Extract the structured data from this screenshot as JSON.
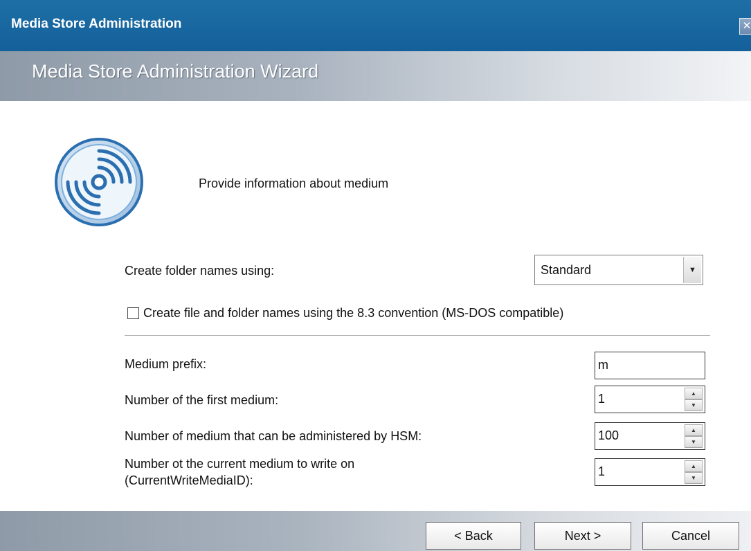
{
  "window": {
    "title": "Media Store Administration",
    "close_glyph": "✕"
  },
  "header": {
    "title": "Media Store Administration Wizard"
  },
  "main": {
    "instruction": "Provide information about medium",
    "folder_names_label": "Create folder names using:",
    "folder_names_value": "Standard",
    "dos_checkbox_label": "Create file and folder names using the 8.3 convention (MS-DOS compatible)",
    "dos_checkbox_checked": false,
    "medium_prefix_label": "Medium prefix:",
    "medium_prefix_value": "m",
    "first_medium_label": "Number of the first medium:",
    "first_medium_value": "1",
    "hsm_count_label": "Number of medium that can be administered by HSM:",
    "hsm_count_value": "100",
    "current_medium_label_line1": "Number ot the current medium to write on",
    "current_medium_label_line2": "(CurrentWriteMediaID):",
    "current_medium_value": "1"
  },
  "footer": {
    "back_label": "< Back",
    "next_label": "Next >",
    "cancel_label": "Cancel"
  },
  "icons": {
    "disc": "disc-icon",
    "dropdown": "chevron-down-icon",
    "spin": "spinner-icon"
  },
  "colors": {
    "titlebar": "#1e6fa6",
    "accent": "#3a7fc1"
  }
}
